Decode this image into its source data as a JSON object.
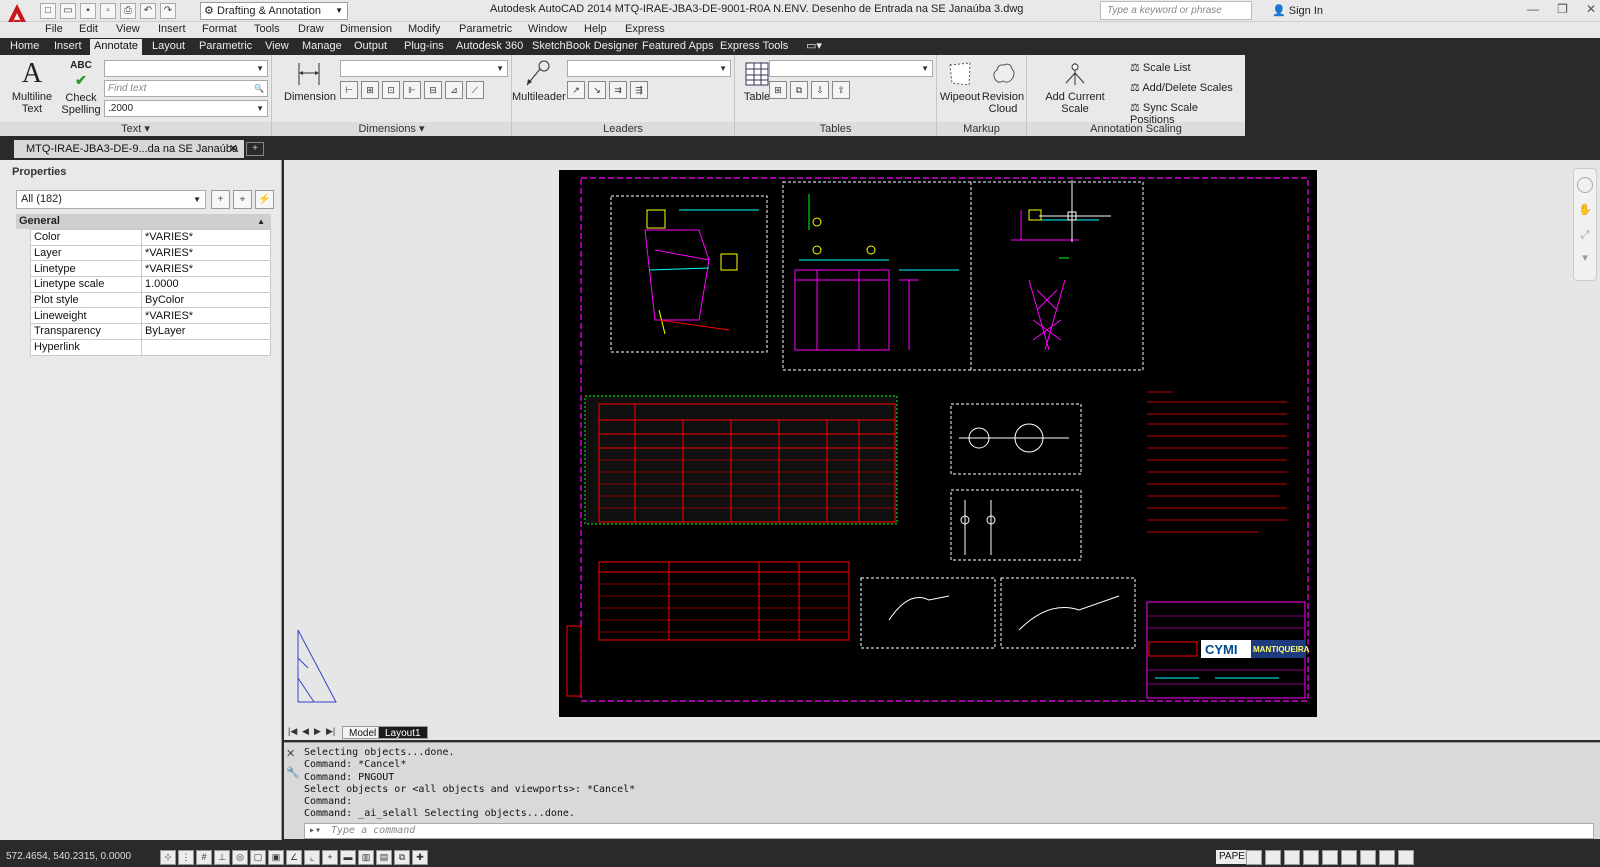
{
  "app": {
    "window_title": "Autodesk AutoCAD 2014    MTQ-IRAE-JBA3-DE-9001-R0A N.ENV. Desenho de Entrada na SE Janaúba 3.dwg",
    "workspace": "Drafting & Annotation",
    "search_placeholder": "Type a keyword or phrase",
    "signin": "Sign In"
  },
  "menu": [
    "File",
    "Edit",
    "View",
    "Insert",
    "Format",
    "Tools",
    "Draw",
    "Dimension",
    "Modify",
    "Parametric",
    "Window",
    "Help",
    "Express"
  ],
  "ribbon_tabs": [
    "Home",
    "Insert",
    "Annotate",
    "Layout",
    "Parametric",
    "View",
    "Manage",
    "Output",
    "Plug-ins",
    "Autodesk 360",
    "SketchBook Designer",
    "Featured Apps",
    "Express Tools"
  ],
  "ribbon": {
    "text_panel": {
      "title": "Text",
      "multiline": "Multiline Text",
      "check_spelling": "Check Spelling",
      "find_placeholder": "Find text",
      "height": ".2000"
    },
    "dimensions_panel": {
      "title": "Dimensions",
      "dimension": "Dimension"
    },
    "leaders_panel": {
      "title": "Leaders",
      "multileader": "Multileader"
    },
    "tables_panel": {
      "title": "Tables",
      "table": "Table"
    },
    "markup_panel": {
      "title": "Markup",
      "wipeout": "Wipeout",
      "revision_cloud": "Revision Cloud"
    },
    "scaling_panel": {
      "title": "Annotation Scaling",
      "add_current_scale": "Add Current Scale",
      "scale_list": "Scale List",
      "add_delete_scales": "Add/Delete Scales",
      "sync_scale_positions": "Sync Scale Positions"
    }
  },
  "document_tab": "MTQ-IRAE-JBA3-DE-9...da na SE Janaúba 3",
  "properties": {
    "title": "Properties",
    "selection": "All (182)",
    "category": "General",
    "rows": [
      {
        "key": "Color",
        "value": "*VARIES*"
      },
      {
        "key": "Layer",
        "value": "*VARIES*"
      },
      {
        "key": "Linetype",
        "value": "*VARIES*"
      },
      {
        "key": "Linetype scale",
        "value": "1.0000"
      },
      {
        "key": "Plot style",
        "value": "ByColor"
      },
      {
        "key": "Lineweight",
        "value": "*VARIES*"
      },
      {
        "key": "Transparency",
        "value": "ByLayer"
      },
      {
        "key": "Hyperlink",
        "value": ""
      }
    ]
  },
  "drawing": {
    "logo_cymi": "CYMI",
    "logo_mantiqueira": "MANTIQUEIRA"
  },
  "layout_tabs": [
    "Model",
    "Layout1"
  ],
  "command_history": [
    "Selecting objects...done.",
    "Command: *Cancel*",
    "Command: PNGOUT",
    "Select objects or <all objects and viewports>: *Cancel*",
    "Command:",
    "Command: _ai_selall Selecting objects...done."
  ],
  "command_placeholder": "Type a command",
  "status": {
    "coords": "572.4654, 540.2315, 0.0000",
    "paper": "PAPER"
  },
  "colors": {
    "ribbon_bg": "#e9e9e9",
    "dark_chrome": "#2a2a2a",
    "sheet_bg": "#000000",
    "cad_magenta": "#ff00ff",
    "cad_red": "#ff0000",
    "cad_yellow": "#ffff00",
    "cad_cyan": "#00ffff"
  }
}
